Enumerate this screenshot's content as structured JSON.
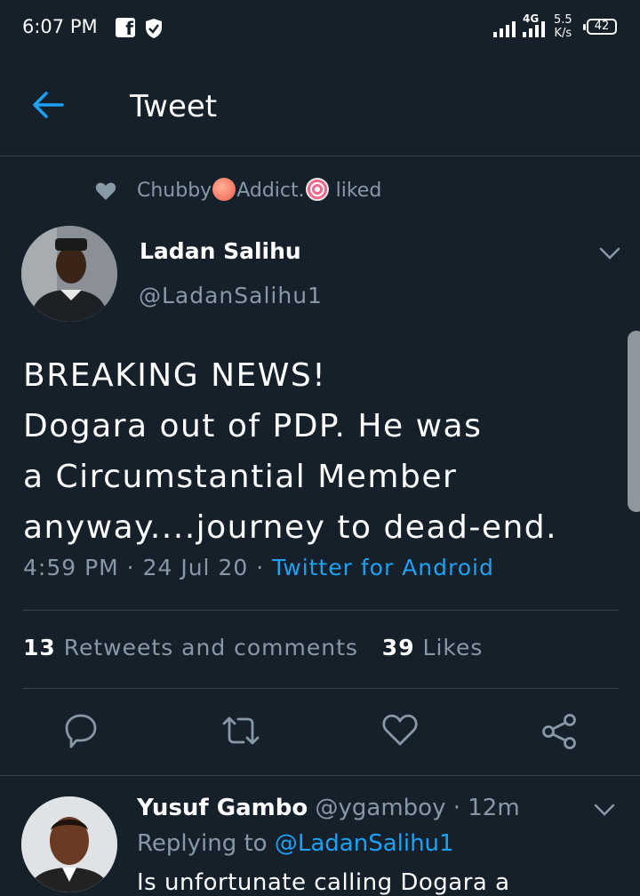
{
  "status_bar": {
    "time": "6:07 PM",
    "network": "4G",
    "speed_top": "5.5",
    "speed_unit": "K/s",
    "battery": "42"
  },
  "header": {
    "title": "Tweet"
  },
  "liked_by": {
    "user_part1": "Chubby",
    "user_part2": "Addict.",
    "suffix": "liked"
  },
  "tweet": {
    "author_name": "Ladan Salihu",
    "author_handle": "@LadanSalihu1",
    "lines": [
      "BREAKING NEWS!",
      "Dogara out of PDP. He was",
      "a Circumstantial Member",
      "anyway....journey to dead-end."
    ],
    "time": "4:59 PM",
    "date": "24 Jul 20",
    "source": "Twitter for Android",
    "retweets_count": "13",
    "retweets_label": "Retweets and comments",
    "likes_count": "39",
    "likes_label": "Likes"
  },
  "reply": {
    "author_name": "Yusuf Gambo",
    "author_handle": "@ygamboy",
    "age": "12m",
    "replying_prefix": "Replying to",
    "replying_to": "@LadanSalihu1",
    "text": "Is unfortunate calling Dogara a"
  },
  "colors": {
    "background": "#15202b",
    "accent": "#1da1f2",
    "muted_text": "#8899a6",
    "divider": "#38444d"
  },
  "icons": [
    "back-arrow-icon",
    "heart-icon",
    "chevron-down-icon",
    "comment-icon",
    "retweet-icon",
    "like-icon",
    "share-icon"
  ]
}
